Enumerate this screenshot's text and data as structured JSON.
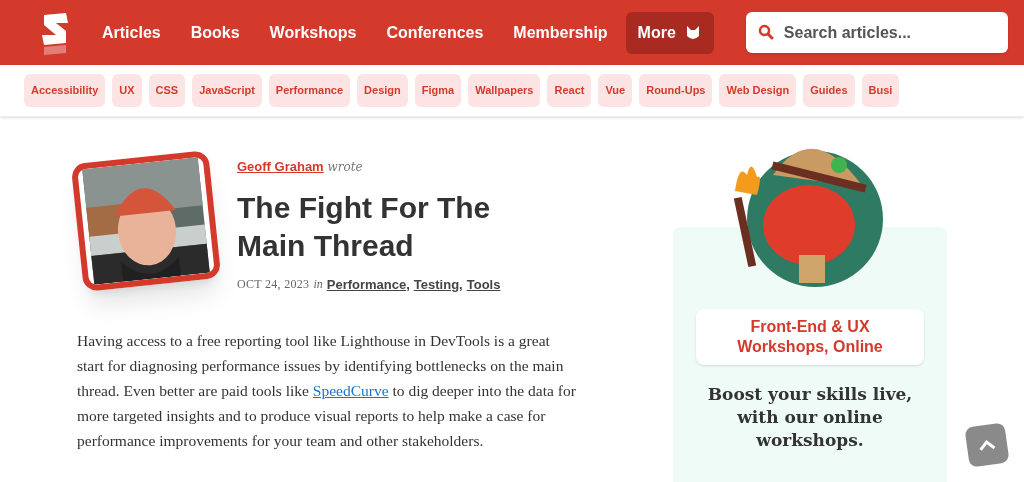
{
  "header": {
    "nav": [
      {
        "label": "Articles",
        "selected": false
      },
      {
        "label": "Books",
        "selected": false
      },
      {
        "label": "Workshops",
        "selected": false
      },
      {
        "label": "Conferences",
        "selected": false
      },
      {
        "label": "Membership",
        "selected": false
      },
      {
        "label": "More",
        "selected": true
      }
    ],
    "search": {
      "placeholder": "Search articles..."
    }
  },
  "tags": [
    "Accessibility",
    "UX",
    "CSS",
    "JavaScript",
    "Performance",
    "Design",
    "Figma",
    "Wallpapers",
    "React",
    "Vue",
    "Round-Ups",
    "Web Design",
    "Guides",
    "Busi"
  ],
  "article": {
    "author": "Geoff Graham",
    "wrote": "wrote",
    "title": "The Fight For The Main Thread",
    "date": "OCT 24, 2023",
    "in": "in",
    "categories": [
      "Performance",
      "Testing",
      "Tools"
    ],
    "separator": ",",
    "paragraph": {
      "before": "Having access to a free reporting tool like Lighthouse in DevTools is a great start for diagnosing performance issues by identifying bottlenecks on the main thread. Even better are paid tools like",
      "link": "SpeedCurve",
      "after": "to dig deeper into the data for more targeted insights and to produce visual reports to help make a case for performance improvements for your team and other stakeholders."
    }
  },
  "sidebar": {
    "badge": "Front-End & UX Workshops, Online",
    "heading": "Boost your skills live, with our online workshops."
  }
}
